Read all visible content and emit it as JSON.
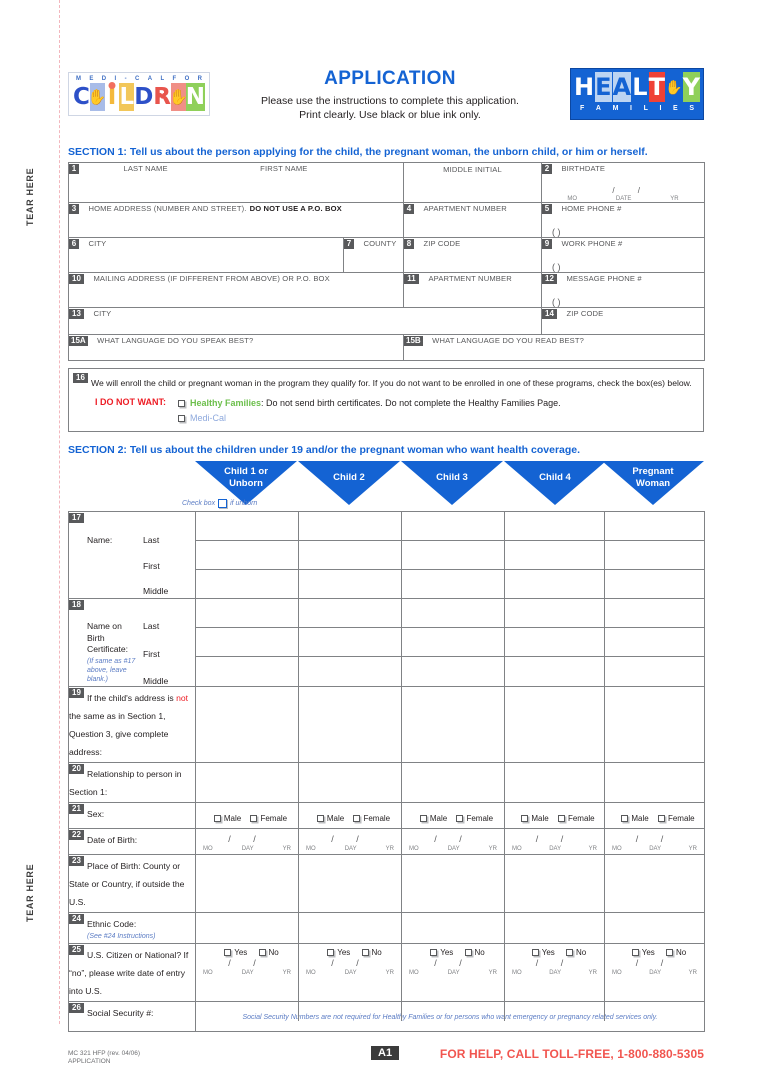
{
  "tear": {
    "label": "TEAR HERE"
  },
  "header": {
    "title": "APPLICATION",
    "sub_line1": "Please use the instructions to complete this application.",
    "sub_line2": "Print clearly. Use black or blue ink only.",
    "logo_left": {
      "name": "medi-cal-for-children-logo",
      "top_text": [
        "M",
        "E",
        "D",
        "I",
        "-",
        "C",
        "A",
        "L",
        "F",
        "O",
        "R"
      ],
      "word": "CHILDREN"
    },
    "logo_right": {
      "name": "healthy-families-logo",
      "word": "HEALTHY",
      "sub": [
        "F",
        "A",
        "M",
        "I",
        "L",
        "I",
        "E",
        "S"
      ]
    }
  },
  "section1": {
    "heading": "SECTION 1: Tell us about the person applying for the child, the pregnant woman, the unborn child, or him or herself.",
    "fields": {
      "q1_num": "1",
      "q1_last": "LAST NAME",
      "q1_first": "FIRST NAME",
      "q1_middle": "MIDDLE INITIAL",
      "q2_num": "2",
      "q2_label": "BIRTHDATE",
      "q3_num": "3",
      "q3_label": "HOME ADDRESS (NUMBER AND STREET).",
      "q3_bold": "DO NOT USE A P.O. BOX",
      "q4_num": "4",
      "q4_label": "APARTMENT NUMBER",
      "q5_num": "5",
      "q5_label": "HOME PHONE #",
      "q6_num": "6",
      "q6_label": "CITY",
      "q7_num": "7",
      "q7_label": "COUNTY",
      "q8_num": "8",
      "q8_label": "ZIP CODE",
      "q9_num": "9",
      "q9_label": "WORK PHONE #",
      "q10_num": "10",
      "q10_label": "MAILING ADDRESS (IF DIFFERENT FROM ABOVE) OR P.O. BOX",
      "q11_num": "11",
      "q11_label": "APARTMENT NUMBER",
      "q12_num": "12",
      "q12_label": "MESSAGE PHONE #",
      "q13_num": "13",
      "q13_label": "CITY",
      "q14_num": "14",
      "q14_label": "ZIP CODE",
      "q15a_num": "15A",
      "q15a_label": "WHAT LANGUAGE DO YOU SPEAK BEST?",
      "q15b_num": "15B",
      "q15b_label": "WHAT LANGUAGE DO YOU READ BEST?"
    },
    "date_parts": {
      "mo": "MO",
      "date": "DATE",
      "yr": "YR"
    },
    "slash": "/",
    "paren": "(          )",
    "q16": {
      "num": "16",
      "text": "We will enroll the child or pregnant woman in the program they qualify for. If you do not want to be enrolled in one of these programs, check the box(es) below.",
      "do_not_want": "I DO NOT WANT:",
      "option1_name": "Healthy Families",
      "option1_rest": ": Do not send birth certificates. Do not complete the Healthy Families Page.",
      "option2_name": "Medi-Cal"
    }
  },
  "section2": {
    "heading": "SECTION 2: Tell us about the children under 19 and/or the pregnant woman who want health coverage.",
    "columns": [
      {
        "line1": "Child 1 or",
        "line2": "Unborn"
      },
      {
        "line1": "Child 2",
        "line2": ""
      },
      {
        "line1": "Child 3",
        "line2": ""
      },
      {
        "line1": "Child 4",
        "line2": ""
      },
      {
        "line1": "Pregnant",
        "line2": "Woman"
      }
    ],
    "unborn_note_before": "Check box",
    "unborn_note_after": "if unborn",
    "rows": {
      "q17_num": "17",
      "q17_label": "Name:",
      "q18_num": "18",
      "q18_label_l1": "Name on",
      "q18_label_l2": "Birth",
      "q18_label_l3": "Certificate:",
      "q18_sub_l1": "(If same as #17",
      "q18_sub_l2": "above, leave",
      "q18_sub_l3": "blank.)",
      "name_parts": [
        "Last",
        "First",
        "Middle"
      ],
      "q19_num": "19",
      "q19_a": "If the child's address is ",
      "q19_not": "not",
      "q19_b": " the same as in Section 1, Question 3, give complete address:",
      "q20_num": "20",
      "q20_label": "Relationship to person in Section 1:",
      "q21_num": "21",
      "q21_label": "Sex:",
      "q21_male": "Male",
      "q21_female": "Female",
      "q22_num": "22",
      "q22_label": "Date of Birth:",
      "q23_num": "23",
      "q23_label": "Place of Birth: County or State or Country, if outside the U.S.",
      "q24_num": "24",
      "q24_label": "Ethnic Code:",
      "q24_sub": "(See #24 Instructions)",
      "q25_num": "25",
      "q25_label": "U.S. Citizen or National? If “no”, please write date of entry into U.S.",
      "q25_yes": "Yes",
      "q25_no": "No",
      "q26_num": "26",
      "q26_label": "Social Security #:",
      "ssn_note": "Social Security Numbers are not required for Healthy Families or for persons who want emergency or pregnancy related services only."
    },
    "mdy": {
      "mo": "MO",
      "day": "DAY",
      "yr": "YR"
    },
    "slash": "/"
  },
  "footer": {
    "form_id_l1": "MC 321 HFP (rev. 04/06)",
    "form_id_l2": "APPLICATION",
    "page_badge": "A1",
    "help": "FOR HELP, CALL TOLL-FREE, 1-800-880-5305"
  },
  "colors": {
    "blue": "#1463d3",
    "red": "#ed1c24",
    "help_red": "#f1554f",
    "green": "#6cbf4b",
    "light_blue": "#8ea9dd",
    "gray_border": "#808285"
  }
}
